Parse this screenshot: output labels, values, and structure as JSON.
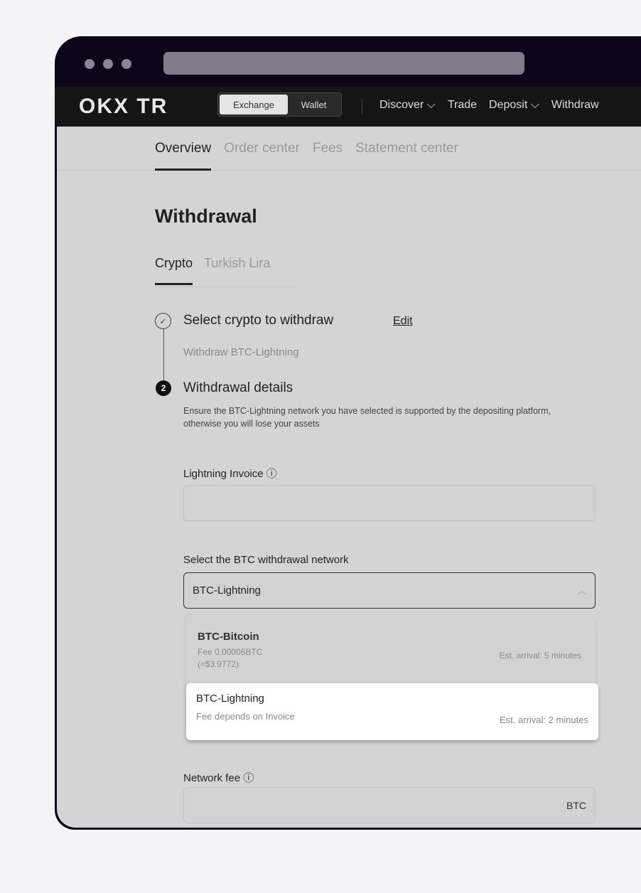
{
  "nav": {
    "logo": "OKX TR",
    "exchange": "Exchange",
    "wallet": "Wallet",
    "links": [
      "Discover ⌵",
      "Trade",
      "Deposit ⌵",
      "Withdraw"
    ]
  },
  "subnav": {
    "tabs": [
      "Overview",
      "Order center",
      "Fees",
      "Statement center"
    ]
  },
  "page": {
    "title": "Withdrawal",
    "tabs": [
      "Crypto",
      "Turkish Lira"
    ]
  },
  "steps": {
    "step1": "Select crypto to withdraw",
    "edit": "Edit",
    "step1_sub": "Withdraw BTC-Lightning",
    "step2_num": "2",
    "step2": "Withdrawal details",
    "warning": "Ensure the BTC-Lightning network you have selected is supported by the depositing platform, otherwise you will lose your assets"
  },
  "form": {
    "invoice_label": "Lightning Invoice ⓘ",
    "invoice_value": "",
    "network_label": "Select the BTC withdrawal network",
    "network_value": "BTC-Lightning",
    "fee_label": "Network fee ⓘ",
    "fee_unit": "BTC"
  },
  "options": [
    {
      "name": "BTC-Bitcoin",
      "fee": "Fee 0.00006BTC",
      "fee_usd": "(≈$3.9772)",
      "arrival": "Est. arrival: 5 minutes"
    },
    {
      "name": "BTC-Lightning",
      "fee": "Fee depends on Invoice",
      "arrival": "Est. arrival: 2 minutes"
    }
  ]
}
